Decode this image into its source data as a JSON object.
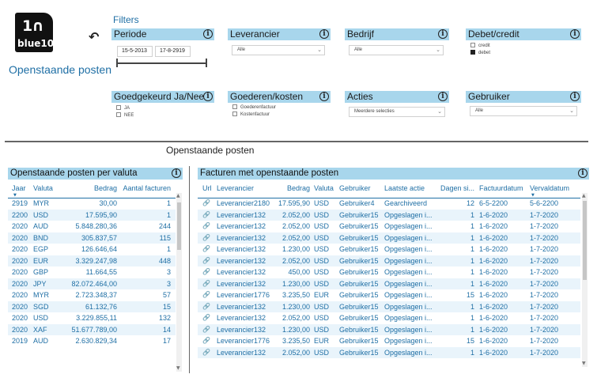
{
  "logo": {
    "mark": "1∩",
    "word": "blue10"
  },
  "page_title": "Openstaande posten",
  "filters_label": "Filters",
  "slicers": {
    "periode": {
      "title": "Periode",
      "from": "15-5-2013",
      "to": "17-8-2919"
    },
    "leverancier": {
      "title": "Leverancier",
      "value": "Alle"
    },
    "bedrijf": {
      "title": "Bedrijf",
      "value": "Alle"
    },
    "debet_credit": {
      "title": "Debet/credit",
      "options": [
        "credit",
        "debet"
      ]
    },
    "goedgekeurd": {
      "title": "Goedgekeurd Ja/Nee",
      "options": [
        "JA",
        "NEE"
      ]
    },
    "goederen": {
      "title": "Goederen/kosten",
      "options": [
        "Goederenfactuur",
        "Kostenfactuur"
      ]
    },
    "acties": {
      "title": "Acties",
      "value": "Meerdere selecties"
    },
    "gebruiker": {
      "title": "Gebruiker",
      "value": "Alle"
    }
  },
  "section_title": "Openstaande posten",
  "left_table": {
    "title": "Openstaande posten per valuta",
    "columns": [
      "Jaar",
      "Valuta",
      "Bedrag",
      "Aantal facturen"
    ],
    "rows": [
      [
        "2919",
        "MYR",
        "30,00",
        "1"
      ],
      [
        "2200",
        "USD",
        "17.595,90",
        "1"
      ],
      [
        "2020",
        "AUD",
        "5.848.280,36",
        "244"
      ],
      [
        "2020",
        "BND",
        "305.837,57",
        "115"
      ],
      [
        "2020",
        "EGP",
        "126.646,64",
        "1"
      ],
      [
        "2020",
        "EUR",
        "3.329.247,98",
        "448"
      ],
      [
        "2020",
        "GBP",
        "11.664,55",
        "3"
      ],
      [
        "2020",
        "JPY",
        "82.072.464,00",
        "3"
      ],
      [
        "2020",
        "MYR",
        "2.723.348,37",
        "57"
      ],
      [
        "2020",
        "SGD",
        "61.132,76",
        "15"
      ],
      [
        "2020",
        "USD",
        "3.229.855,11",
        "132"
      ],
      [
        "2020",
        "XAF",
        "51.677.789,00",
        "14"
      ],
      [
        "2019",
        "AUD",
        "2.630.829,34",
        "17"
      ]
    ]
  },
  "right_table": {
    "title": "Facturen met openstaande posten",
    "columns": [
      "Url",
      "Leverancier",
      "Bedrag",
      "Valuta",
      "Gebruiker",
      "Laatste actie",
      "Dagen si...",
      "Factuurdatum",
      "Vervaldatum"
    ],
    "rows": [
      [
        "Leverancier2180",
        "17.595,90",
        "USD",
        "Gebruiker4",
        "Gearchiveerd",
        "12",
        "6-5-2200",
        "5-6-2200"
      ],
      [
        "Leverancier132",
        "2.052,00",
        "USD",
        "Gebruiker15",
        "Opgeslagen i...",
        "1",
        "1-6-2020",
        "1-7-2020"
      ],
      [
        "Leverancier132",
        "2.052,00",
        "USD",
        "Gebruiker15",
        "Opgeslagen i...",
        "1",
        "1-6-2020",
        "1-7-2020"
      ],
      [
        "Leverancier132",
        "2.052,00",
        "USD",
        "Gebruiker15",
        "Opgeslagen i...",
        "1",
        "1-6-2020",
        "1-7-2020"
      ],
      [
        "Leverancier132",
        "1.230,00",
        "USD",
        "Gebruiker15",
        "Opgeslagen i...",
        "1",
        "1-6-2020",
        "1-7-2020"
      ],
      [
        "Leverancier132",
        "2.052,00",
        "USD",
        "Gebruiker15",
        "Opgeslagen i...",
        "1",
        "1-6-2020",
        "1-7-2020"
      ],
      [
        "Leverancier132",
        "450,00",
        "USD",
        "Gebruiker15",
        "Opgeslagen i...",
        "1",
        "1-6-2020",
        "1-7-2020"
      ],
      [
        "Leverancier132",
        "1.230,00",
        "USD",
        "Gebruiker15",
        "Opgeslagen i...",
        "1",
        "1-6-2020",
        "1-7-2020"
      ],
      [
        "Leverancier1776",
        "3.235,50",
        "EUR",
        "Gebruiker15",
        "Opgeslagen i...",
        "15",
        "1-6-2020",
        "1-7-2020"
      ],
      [
        "Leverancier132",
        "1.230,00",
        "USD",
        "Gebruiker15",
        "Opgeslagen i...",
        "1",
        "1-6-2020",
        "1-7-2020"
      ],
      [
        "Leverancier132",
        "2.052,00",
        "USD",
        "Gebruiker15",
        "Opgeslagen i...",
        "1",
        "1-6-2020",
        "1-7-2020"
      ],
      [
        "Leverancier132",
        "1.230,00",
        "USD",
        "Gebruiker15",
        "Opgeslagen i...",
        "1",
        "1-6-2020",
        "1-7-2020"
      ],
      [
        "Leverancier1776",
        "3.235,50",
        "EUR",
        "Gebruiker15",
        "Opgeslagen i...",
        "15",
        "1-6-2020",
        "1-7-2020"
      ],
      [
        "Leverancier132",
        "2.052,00",
        "USD",
        "Gebruiker15",
        "Opgeslagen i...",
        "1",
        "1-6-2020",
        "1-7-2020"
      ]
    ]
  },
  "icons": {
    "info": "info-icon",
    "undo": "undo-icon",
    "link": "link-icon",
    "chevron": "chevron-down-icon"
  },
  "colors": {
    "accent": "#1f6fa5",
    "header_bg": "#a8d6ec",
    "alt_row": "#e9f4fb"
  }
}
